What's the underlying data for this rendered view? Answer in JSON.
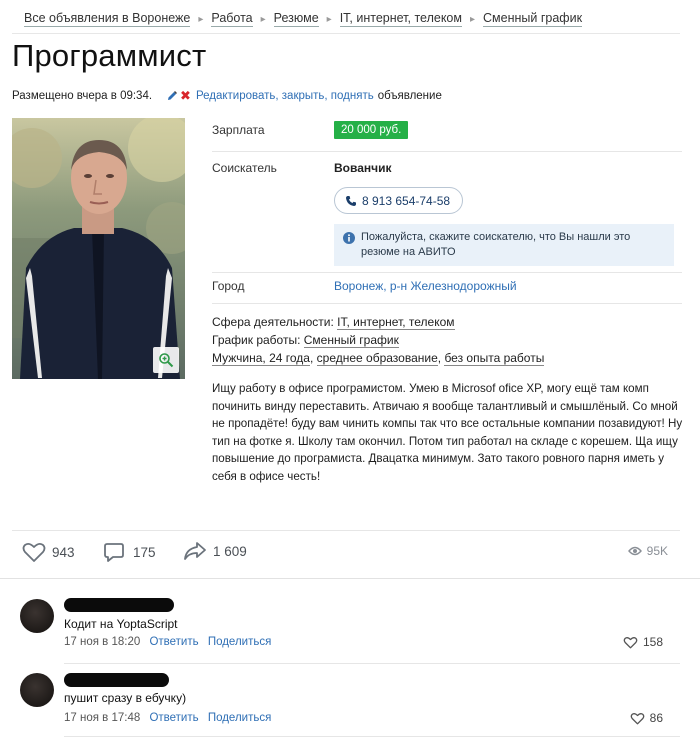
{
  "breadcrumbs": [
    "Все объявления в Воронеже",
    "Работа",
    "Резюме",
    "IT, интернет, телеком",
    "Сменный график"
  ],
  "title": "Программист",
  "meta": {
    "posted": "Размещено вчера в 09:34.",
    "edit_links": "Редактировать, закрыть, поднять",
    "edit_tail": "объявление"
  },
  "details": {
    "salary_label": "Зарплата",
    "salary_value": "20 000 руб.",
    "seeker_label": "Соискатель",
    "seeker_name": "Вованчик",
    "phone": "8 913 654-74-58",
    "notice": "Пожалуйста, скажите соискателю, что Вы нашли это резюме на АВИТО",
    "city_label": "Город",
    "city_value": "Воронеж, р-н Железнодорожный"
  },
  "specs": {
    "sphere_label": "Сфера деятельности:",
    "sphere_value": "IT, интернет, телеком",
    "schedule_label": "График работы:",
    "schedule_value": "Сменный график",
    "gender_age": "Мужчина, 24 года",
    "education": "среднее образование",
    "experience": "без опыта работы"
  },
  "description": "Ищу работу в офисе програмистом. Умею в Microsof ofice XP, могу ещё там комп починить винду переставить. Атвичаю я вообще талантливый и смышлёный. Со мной не пропадёте! буду вам чинить компы так что все остальные компании позавидуют! Ну тип на фотке я. Школу там окончил. Потом тип работал на складе с корешем. Ща ищу повышение до програмиста. Двацатка минимум. Зато такого ровного парня иметь у себя в офисе честь!",
  "social": {
    "likes": "943",
    "comments": "175",
    "shares": "1 609",
    "views": "95K"
  },
  "comments": [
    {
      "text": "Кодит на YoptaScript",
      "time": "17 ноя в 18:20",
      "reply": "Ответить",
      "share": "Поделиться",
      "likes": "158"
    },
    {
      "text": "пушит сразу в ебучку)",
      "time": "17 ноя в 17:48",
      "reply": "Ответить",
      "share": "Поделиться",
      "likes": "86"
    }
  ],
  "colors": {
    "link": "#2f6fb5",
    "salary_badge": "#25b047",
    "delete_icon": "#d8262b",
    "notice_bg": "#e9f1f9"
  },
  "icons": [
    "edit-pencil-icon",
    "close-x-icon",
    "zoom-icon",
    "phone-icon",
    "info-icon",
    "heart-icon",
    "comment-icon",
    "share-arrow-icon",
    "eye-icon"
  ]
}
